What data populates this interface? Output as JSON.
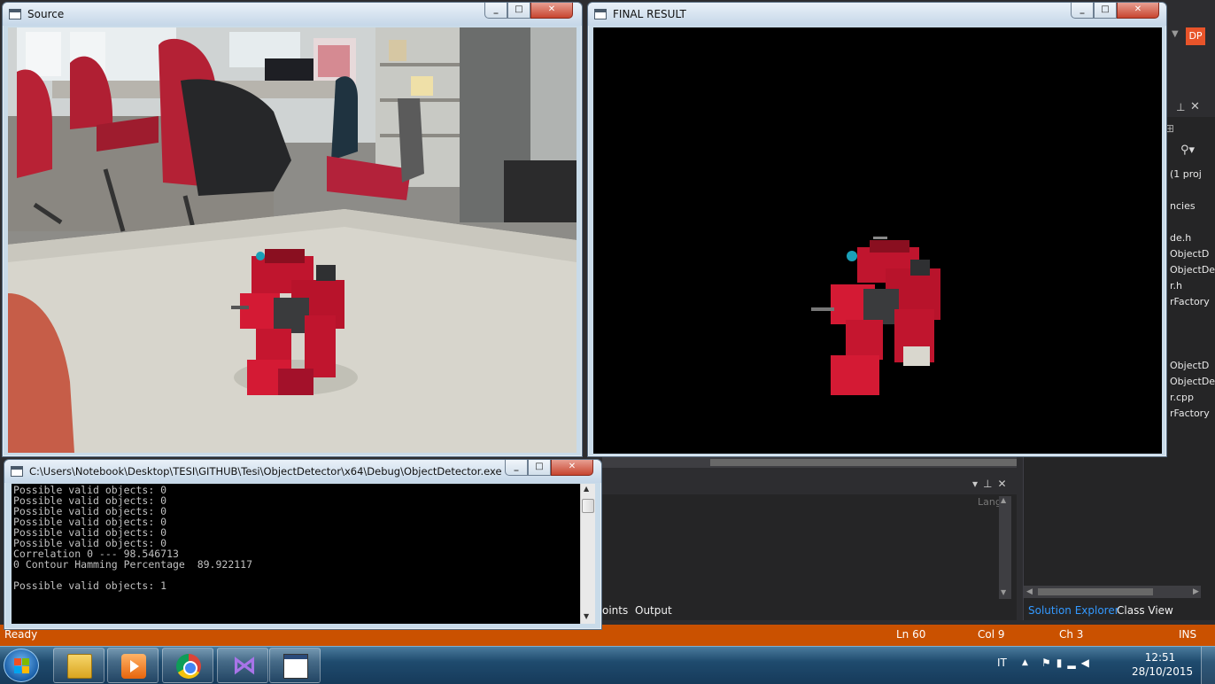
{
  "vs": {
    "user_badge": "DP",
    "solution_panel": {
      "tree_items": [
        "(1 proj",
        "ncies",
        "de.h",
        "ObjectD",
        "ObjectDe",
        "r.h",
        "rFactory",
        "ObjectD",
        "ObjectDe",
        "r.cpp",
        "rFactory"
      ],
      "tab_explorer": "Solution Explorer",
      "tab_classview": "Class View"
    },
    "output_panel": {
      "lang_label": "Lang",
      "tab_points": "oints",
      "tab_output": "Output"
    },
    "status": {
      "text": "Ready",
      "ln": "Ln 60",
      "col": "Col 9",
      "ch": "Ch 3",
      "ins": "INS"
    }
  },
  "windows": {
    "source": {
      "title": "Source"
    },
    "final": {
      "title": "FINAL RESULT"
    },
    "console": {
      "title": "C:\\Users\\Notebook\\Desktop\\TESI\\GITHUB\\Tesi\\ObjectDetector\\x64\\Debug\\ObjectDetector.exe",
      "lines": "Possible valid objects: 0\nPossible valid objects: 0\nPossible valid objects: 0\nPossible valid objects: 0\nPossible valid objects: 0\nPossible valid objects: 0\nCorrelation 0 --- 98.546713\n0 Contour Hamming Percentage  89.922117\n\nPossible valid objects: 1"
    },
    "controls": {
      "min": "_",
      "max": "□",
      "close": "✕"
    }
  },
  "taskbar": {
    "apps": [
      "windows-explorer",
      "media-player",
      "chrome",
      "visual-studio",
      "console"
    ],
    "language": "IT",
    "time": "12:51",
    "date": "28/10/2015"
  }
}
